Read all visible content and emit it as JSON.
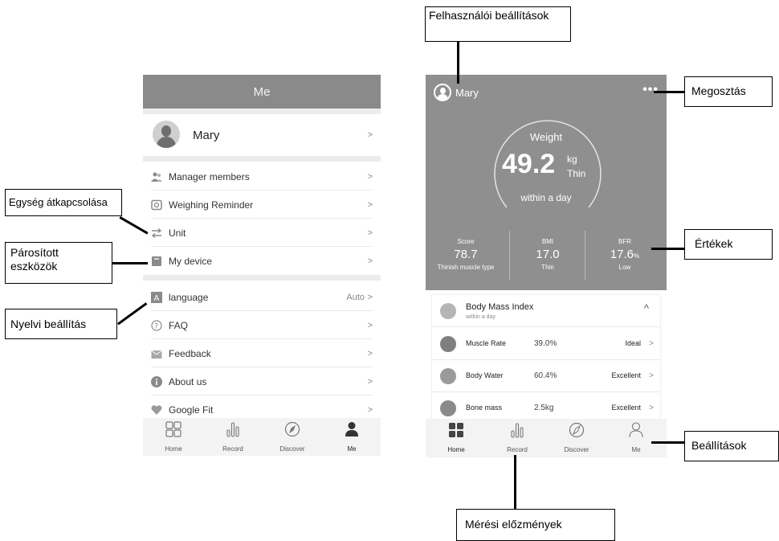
{
  "left_screen": {
    "header_title": "Me",
    "profile_name": "Mary",
    "chevron": ">",
    "menu": [
      {
        "label": "Manager members",
        "icon": "members-icon"
      },
      {
        "label": "Weighing Reminder",
        "icon": "alarm-clock-icon"
      },
      {
        "label": "Unit",
        "icon": "swap-arrows-icon"
      },
      {
        "label": "My device",
        "icon": "device-icon"
      },
      {
        "label": "language",
        "icon": "language-icon",
        "value": "Auto"
      },
      {
        "label": "FAQ",
        "icon": "question-icon"
      },
      {
        "label": "Feedback",
        "icon": "mail-icon"
      },
      {
        "label": "About us",
        "icon": "info-icon"
      },
      {
        "label": "Google Fit",
        "icon": "heart-icon"
      }
    ],
    "tabs": [
      {
        "label": "Home",
        "icon": "home-grid-icon"
      },
      {
        "label": "Record",
        "icon": "bar-chart-icon"
      },
      {
        "label": "Discover",
        "icon": "compass-icon"
      },
      {
        "label": "Me",
        "icon": "person-icon"
      }
    ]
  },
  "right_screen": {
    "profile_name": "Mary",
    "more": "•••",
    "weight_label": "Weight",
    "weight_value": "49.2",
    "weight_unit": "kg",
    "weight_status": "Thin",
    "weight_time": "within a day",
    "metrics": [
      {
        "label": "Score",
        "value": "78.7",
        "sub": "Thinish muscle type"
      },
      {
        "label": "BMI",
        "value": "17.0",
        "sub": "Thin"
      },
      {
        "label": "BFR",
        "value": "17.6",
        "unit": "%",
        "sub": "Low"
      }
    ],
    "bmi_card": {
      "title": "Body Mass Index",
      "subtitle": "within a day",
      "caret": "^"
    },
    "rows": [
      {
        "name": "Muscle Rate",
        "value": "39.0%",
        "status": "Ideal"
      },
      {
        "name": "Body Water",
        "value": "60.4%",
        "status": "Excellent"
      },
      {
        "name": "Bone mass",
        "value": "2.5kg",
        "status": "Excellent"
      }
    ],
    "tabs": [
      {
        "label": "Home",
        "icon": "home-grid-icon"
      },
      {
        "label": "Record",
        "icon": "bar-chart-icon"
      },
      {
        "label": "Discover",
        "icon": "compass-icon"
      },
      {
        "label": "Me",
        "icon": "person-icon"
      }
    ]
  },
  "annotations": {
    "user_settings": "Felhasználói beállítások",
    "share": "Megosztás",
    "values": "Értékek",
    "settings": "Beállítások",
    "history": "Mérési előzmények",
    "unit_switch": "Egység átkapcsolása",
    "paired_devices": "Párosított eszközök",
    "language_setting": "Nyelvi beállítás"
  },
  "colors": {
    "header_gray": "#8a8a8a",
    "panel_gray": "#8f8f8f",
    "divider": "#eaeaea"
  }
}
